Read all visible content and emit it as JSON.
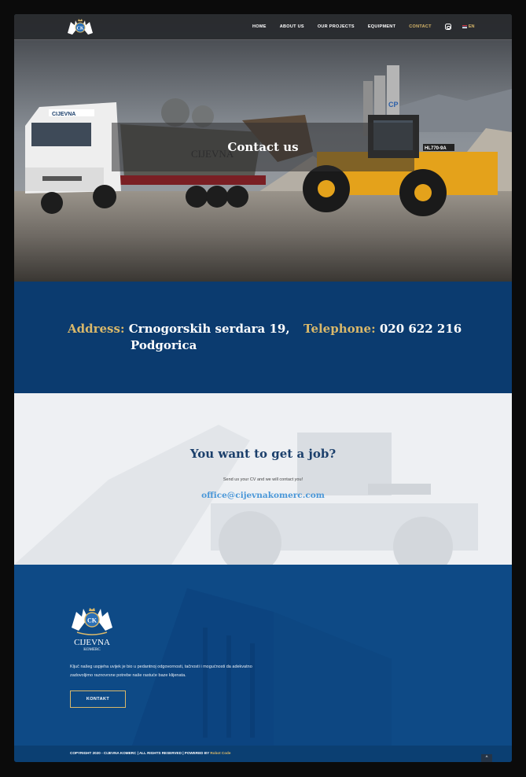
{
  "nav": {
    "items": [
      {
        "label": "HOME"
      },
      {
        "label": "ABOUT US"
      },
      {
        "label": "OUR PROJECTS"
      },
      {
        "label": "EQUIPMENT"
      },
      {
        "label": "CONTACT"
      }
    ],
    "active_index": 4,
    "lang": "EN",
    "icons": [
      "logo-cijevna-komerc",
      "instagram-icon",
      "montenegro-flag-icon"
    ]
  },
  "hero": {
    "title": "Contact us"
  },
  "contact": {
    "address_label": "Address:",
    "address_line1": "Crnogorskih serdara 19,",
    "address_line2": "Podgorica",
    "telephone_label": "Telephone:",
    "telephone_value": "020 622 216"
  },
  "job": {
    "title": "You want to get a job?",
    "subtitle": "Send us your CV and we will contact you!",
    "email": "office@cijevnakomerc.com"
  },
  "footer": {
    "logo_text": "CIJEVNA",
    "logo_text2": "KOMERC",
    "logo_monogram": "CK",
    "description": "Ključ našeg uspjeha uvijek je bio u pedantnoj odgovornosti, tačnosti i mogućnosti da adekvatno zadovoljimo raznovrsne potrebe naše rastuće baze klijenata.",
    "button_label": "KONTAKT",
    "copyright": "COPYRIGHT 2020 - CIJEVNA KOMERC  |  ALL RIGHTS RESERVED  |  POWERED BY ",
    "powered_by": "Robot Code",
    "to_top": "^"
  },
  "colors": {
    "gold": "#d9b86a",
    "navy": "#0b3b6f",
    "footer_blue": "#0e4a86",
    "email_blue": "#4a97d8",
    "job_title": "#1b3f6b"
  }
}
